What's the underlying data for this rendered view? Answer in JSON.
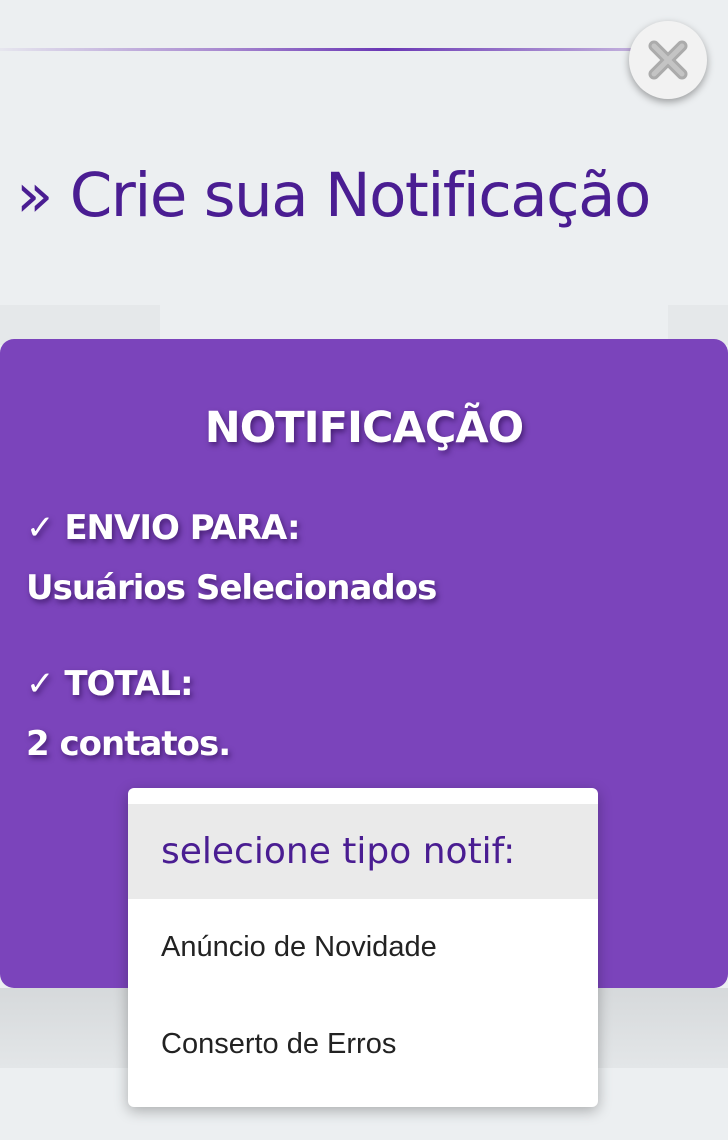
{
  "header": {
    "title": "» Crie sua Notificação",
    "close_icon": "close-x-icon"
  },
  "card": {
    "title": "NOTIFICAÇÃO",
    "send_to_label": "✓ ENVIO PARA:",
    "send_to_value": "Usuários Selecionados",
    "total_label": "✓ TOTAL:",
    "total_value": "2 contatos."
  },
  "dropdown": {
    "placeholder": "selecione tipo notif:",
    "options": [
      "Anúncio de Novidade",
      "Conserto de Erros"
    ]
  },
  "colors": {
    "accent_purple": "#7b44bb",
    "title_purple": "#4a1d92",
    "background": "#eceff1"
  }
}
